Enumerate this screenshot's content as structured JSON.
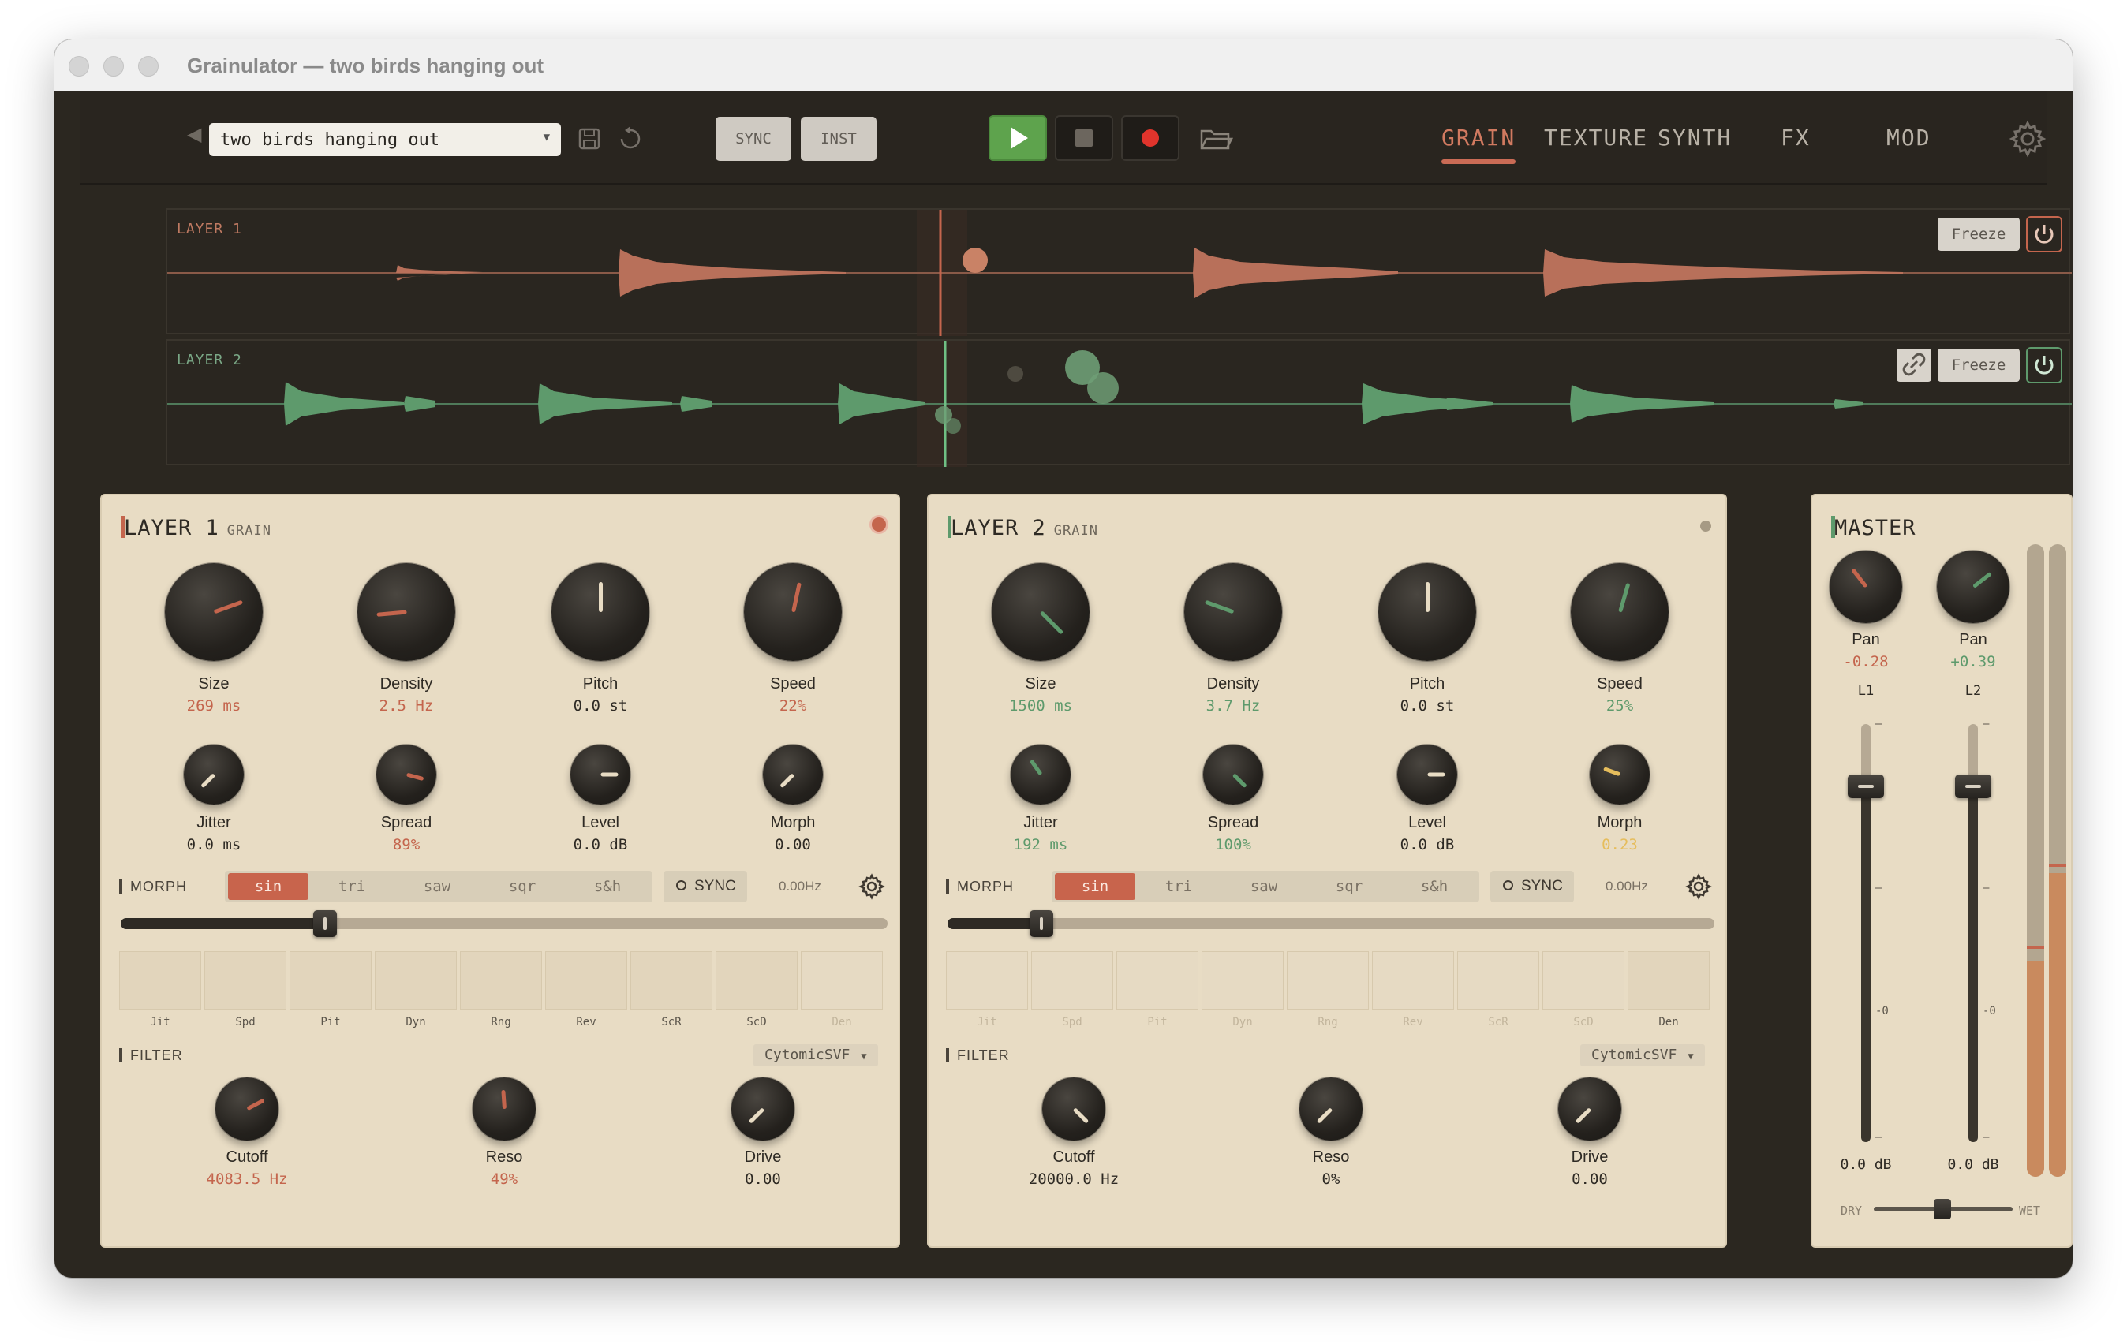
{
  "window": {
    "title": "Grainulator — two birds hanging out"
  },
  "toolbar": {
    "preset_name": "two birds hanging out",
    "sync_label": "SYNC",
    "inst_label": "INST",
    "tabs": [
      {
        "label": "GRAIN",
        "active": true
      },
      {
        "label": "TEXTURE",
        "active": false
      },
      {
        "label": "SYNTH",
        "active": false
      },
      {
        "label": "FX",
        "active": false
      },
      {
        "label": "MOD",
        "active": false
      }
    ]
  },
  "waveforms": [
    {
      "label": "LAYER 1",
      "freeze_label": "Freeze",
      "color": "#c27a63",
      "power_color": "#c4654d"
    },
    {
      "label": "LAYER 2",
      "freeze_label": "Freeze",
      "color": "#5e9a6c",
      "power_color": "#5e9a6c"
    }
  ],
  "layers": [
    {
      "title": "LAYER 1",
      "subtitle": "GRAIN",
      "accent": "#c4654d",
      "knobs_large": [
        {
          "label": "Size",
          "value": "269 ms"
        },
        {
          "label": "Density",
          "value": "2.5 Hz"
        },
        {
          "label": "Pitch",
          "value": "0.0 st"
        },
        {
          "label": "Speed",
          "value": "22%"
        }
      ],
      "knobs_small": [
        {
          "label": "Jitter",
          "value": "0.0 ms"
        },
        {
          "label": "Spread",
          "value": "89%"
        },
        {
          "label": "Level",
          "value": "0.0 dB"
        },
        {
          "label": "Morph",
          "value": "0.00"
        }
      ],
      "morph": {
        "label": "MORPH",
        "waves": [
          "sin",
          "tri",
          "saw",
          "sqr",
          "s&h"
        ],
        "selected": "sin",
        "sync_label": "SYNC",
        "rate": "0.00Hz",
        "slider": 0.27
      },
      "mod_targets": [
        "Jit",
        "Spd",
        "Pit",
        "Dyn",
        "Rng",
        "Rev",
        "ScR",
        "ScD",
        "Den"
      ],
      "filter": {
        "label": "FILTER",
        "type": "CytomicSVF",
        "knobs": [
          {
            "label": "Cutoff",
            "value": "4083.5 Hz"
          },
          {
            "label": "Reso",
            "value": "49%"
          },
          {
            "label": "Drive",
            "value": "0.00"
          }
        ]
      }
    },
    {
      "title": "LAYER 2",
      "subtitle": "GRAIN",
      "accent": "#5e9a6c",
      "knobs_large": [
        {
          "label": "Size",
          "value": "1500 ms"
        },
        {
          "label": "Density",
          "value": "3.7 Hz"
        },
        {
          "label": "Pitch",
          "value": "0.0 st"
        },
        {
          "label": "Speed",
          "value": "25%"
        }
      ],
      "knobs_small": [
        {
          "label": "Jitter",
          "value": "192 ms"
        },
        {
          "label": "Spread",
          "value": "100%"
        },
        {
          "label": "Level",
          "value": "0.0 dB"
        },
        {
          "label": "Morph",
          "value": "0.23"
        }
      ],
      "morph": {
        "label": "MORPH",
        "waves": [
          "sin",
          "tri",
          "saw",
          "sqr",
          "s&h"
        ],
        "selected": "sin",
        "sync_label": "SYNC",
        "rate": "0.00Hz",
        "slider": 0.11
      },
      "mod_targets": [
        "Jit",
        "Spd",
        "Pit",
        "Dyn",
        "Rng",
        "Rev",
        "ScR",
        "ScD",
        "Den"
      ],
      "filter": {
        "label": "FILTER",
        "type": "CytomicSVF",
        "knobs": [
          {
            "label": "Cutoff",
            "value": "20000.0 Hz"
          },
          {
            "label": "Reso",
            "value": "0%"
          },
          {
            "label": "Drive",
            "value": "0.00"
          }
        ]
      }
    }
  ],
  "master": {
    "title": "MASTER",
    "pans": [
      {
        "label": "Pan",
        "value": "-0.28",
        "channel": "L1"
      },
      {
        "label": "Pan",
        "value": "+0.39",
        "channel": "L2"
      }
    ],
    "fader_ticks": [
      "–",
      "–",
      "-0",
      "–"
    ],
    "fader_values": [
      "0.0 dB",
      "0.0 dB"
    ],
    "dry_label": "DRY",
    "wet_label": "WET",
    "dry_wet": 0.5,
    "meter_levels": [
      0.34,
      0.48
    ]
  }
}
